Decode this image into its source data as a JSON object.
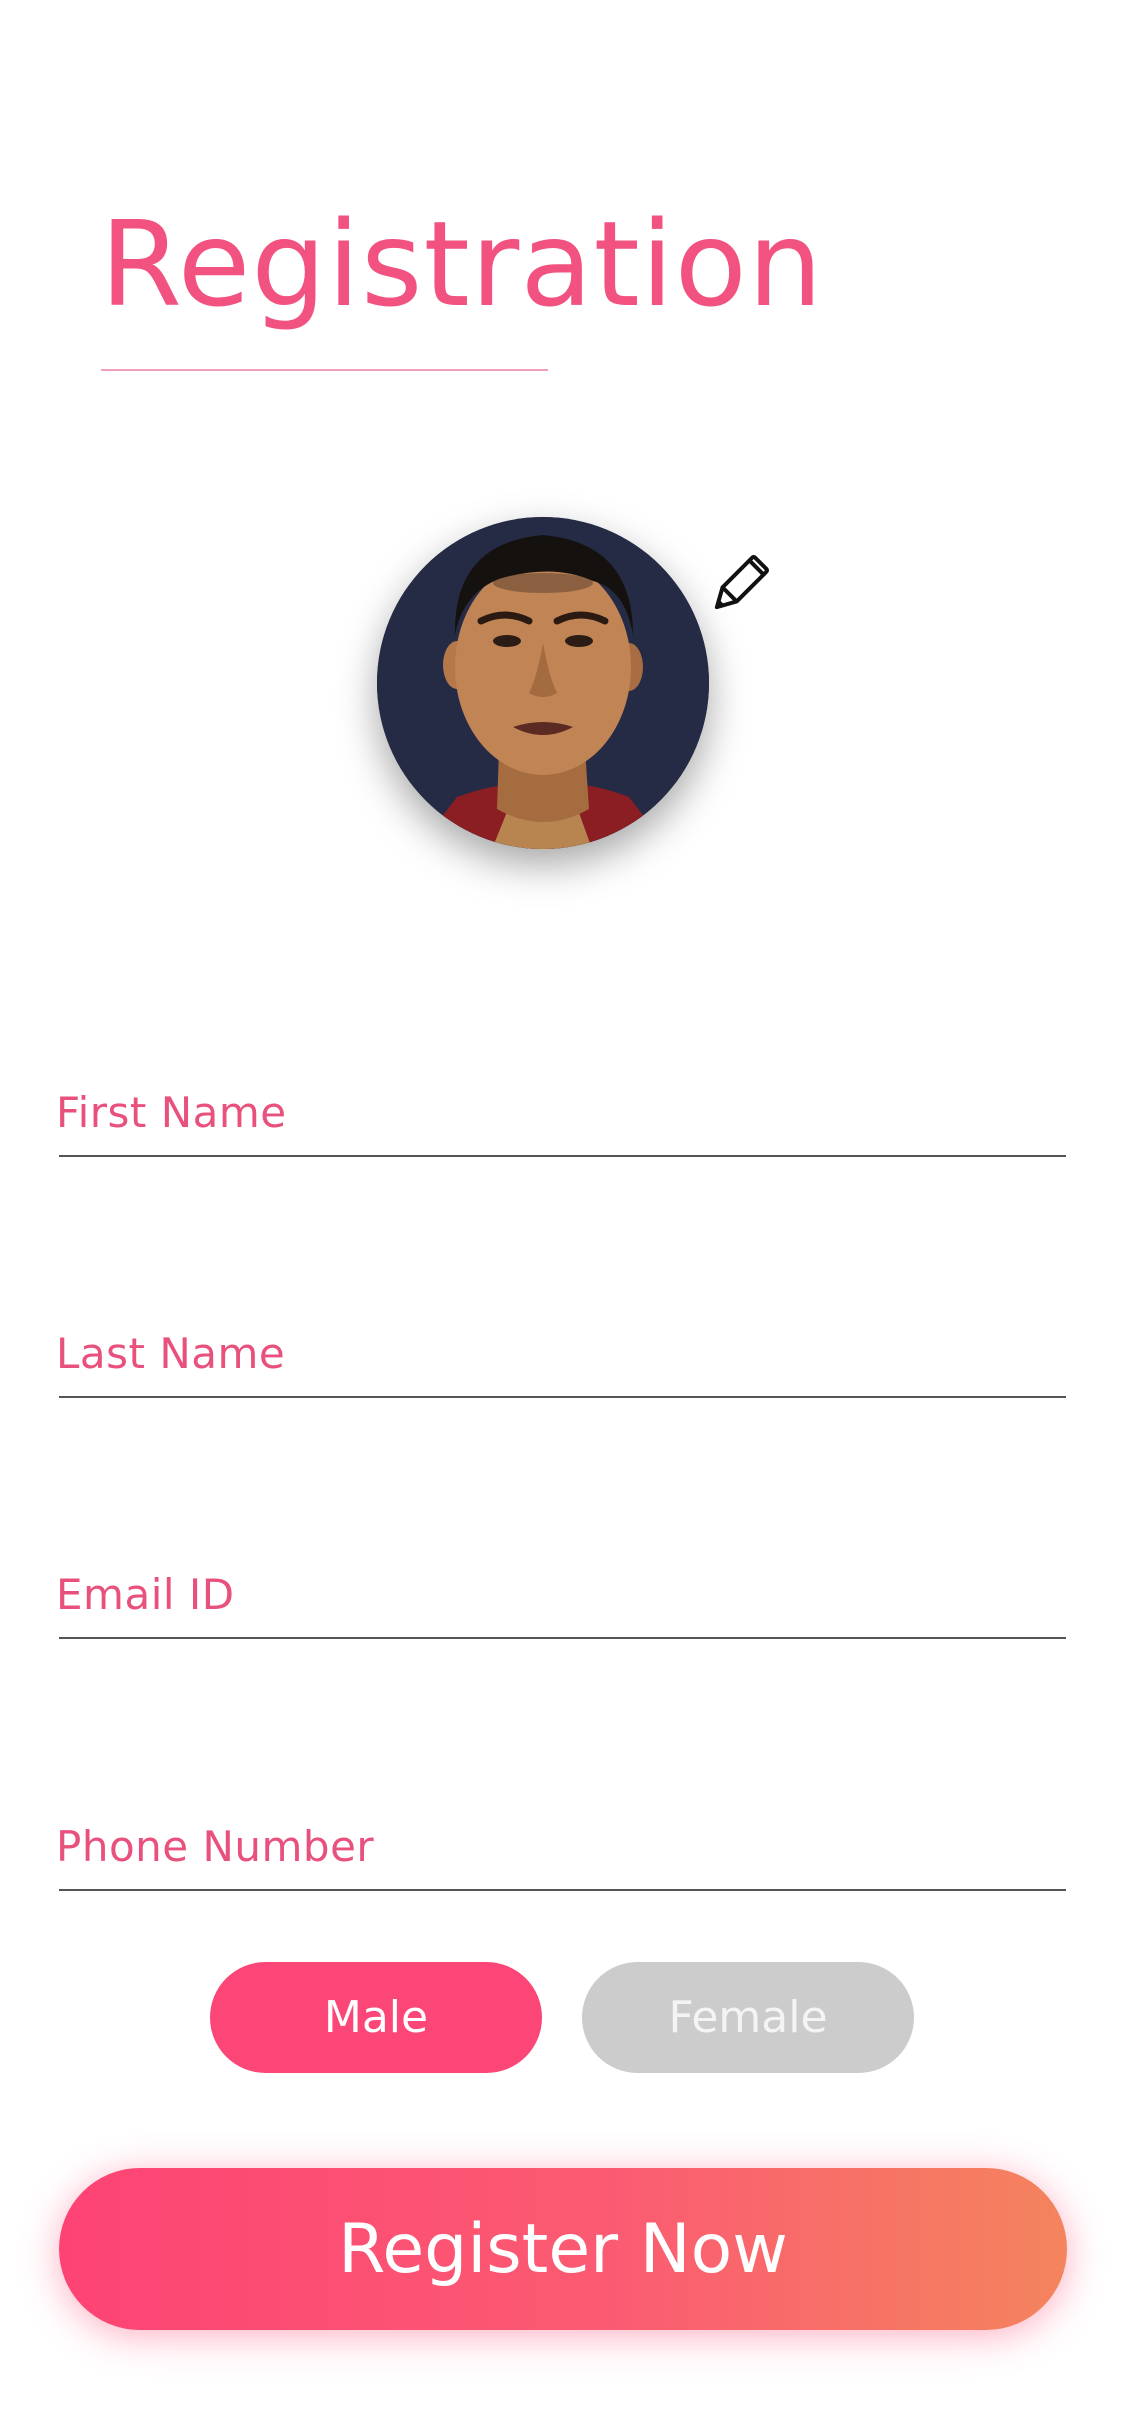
{
  "header": {
    "title": "Registration"
  },
  "profile": {
    "avatar_icon": "profile-photo",
    "edit_icon": "pencil-icon"
  },
  "form": {
    "first_name_label": "First Name",
    "last_name_label": "Last Name",
    "email_label": "Email ID",
    "phone_label": "Phone Number"
  },
  "gender": {
    "male_label": "Male",
    "female_label": "Female",
    "selected": "Male"
  },
  "actions": {
    "register_label": "Register Now"
  },
  "colors": {
    "accent": "#f1527f",
    "button_gradient_start": "#fd4374",
    "button_gradient_end": "#f4845d",
    "inactive": "#cccccc"
  }
}
